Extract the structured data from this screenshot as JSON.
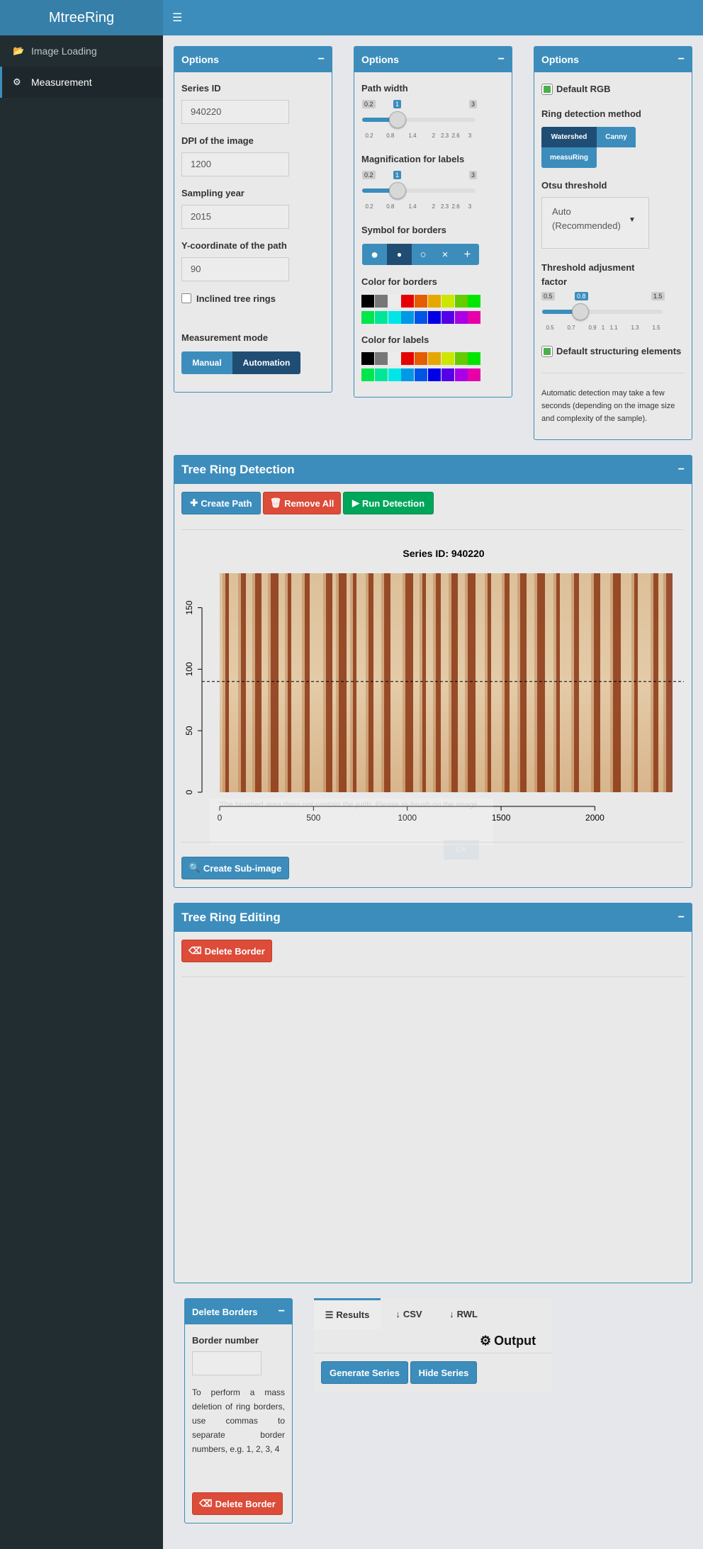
{
  "app": {
    "title": "MtreeRing"
  },
  "sidebar": {
    "items": [
      {
        "label": "Image Loading",
        "icon": "folder-open-icon"
      },
      {
        "label": "Measurement",
        "icon": "gear-icon"
      }
    ]
  },
  "options1": {
    "title": "Options",
    "series_id_label": "Series ID",
    "series_id_value": "940220",
    "dpi_label": "DPI of the image",
    "dpi_value": "1200",
    "year_label": "Sampling year",
    "year_value": "2015",
    "ycoord_label": "Y-coordinate of the path",
    "ycoord_value": "90",
    "inclined_label": "Inclined tree rings",
    "inclined_checked": false,
    "mode_label": "Measurement mode",
    "mode_options": [
      "Manual",
      "Automation"
    ],
    "mode_selected": "Automation"
  },
  "options2": {
    "title": "Options",
    "path_width": {
      "label": "Path width",
      "min": "0.2",
      "max": "3",
      "value": "1",
      "ticks": [
        "0.2",
        "0.8",
        "1.4",
        "2",
        "2.3",
        "2.6",
        "3"
      ]
    },
    "magnification": {
      "label": "Magnification for labels",
      "min": "0.2",
      "max": "3",
      "value": "1",
      "ticks": [
        "0.2",
        "0.8",
        "1.4",
        "2",
        "2.3",
        "2.6",
        "3"
      ]
    },
    "symbol_label": "Symbol for borders",
    "symbols": [
      "●",
      "●",
      "○",
      "×",
      "+"
    ],
    "symbol_selected": 1,
    "border_color_label": "Color for borders",
    "label_color_label": "Color for labels",
    "palette": [
      "#000000",
      "#777777",
      "#ececec",
      "#e60000",
      "#e65c00",
      "#e6a800",
      "#cce600",
      "#66cc00",
      "#00e600",
      "#00e64d",
      "#00e699",
      "#00e6e6",
      "#0099e6",
      "#0055e6",
      "#0000e6",
      "#5500e6",
      "#aa00e6",
      "#e600aa"
    ]
  },
  "options3": {
    "title": "Options",
    "default_rgb_label": "Default RGB",
    "default_rgb_checked": true,
    "method_label": "Ring detection method",
    "methods": [
      "Watershed",
      "Canny",
      "measuRing"
    ],
    "method_selected": "Watershed",
    "otsu_label": "Otsu threshold",
    "otsu_value": "Auto (Recommended)",
    "factor_label": "Threshold adjusment factor",
    "factor": {
      "min": "0.5",
      "max": "1.5",
      "value": "0.8",
      "ticks": [
        "0.5",
        "0.7",
        "0.9",
        "1",
        "1.1",
        "1.3",
        "1.5"
      ]
    },
    "struct_label": "Default structuring elements",
    "struct_checked": true,
    "note": "Automatic detection may take a few seconds (depending on the image size and complexity of the sample)."
  },
  "detection": {
    "title": "Tree Ring Detection",
    "buttons": {
      "create_path": "Create Path",
      "remove_all": "Remove All",
      "run_detection": "Run Detection"
    },
    "sub_image": "Create Sub-image",
    "overlay_text": "The brushed area does not contain the path. Please re-brush on the image.",
    "overlay_ok": "OK"
  },
  "chart_data": {
    "type": "image",
    "title": "Series ID: 940220",
    "xticks": [
      "0",
      "500",
      "1000",
      "1500",
      "2000"
    ],
    "yticks": [
      "0",
      "50",
      "100",
      "150"
    ],
    "xlim": [
      0,
      2380
    ],
    "ylim": [
      0,
      178
    ],
    "path_y": 90,
    "ring_color_light": "#d9b88a",
    "ring_color_dark": "#8a3512"
  },
  "editing": {
    "title": "Tree Ring Editing",
    "delete_border": "Delete Border"
  },
  "delete_borders": {
    "title": "Delete Borders",
    "number_label": "Border number",
    "number_value": "",
    "note": "To perform a mass deletion of ring borders, use commas to separate border numbers, e.g. 1, 2, 3, 4",
    "button": "Delete Border"
  },
  "output": {
    "tabs": [
      "Results",
      "CSV",
      "RWL"
    ],
    "active_tab": "Results",
    "heading": "Output",
    "generate": "Generate Series",
    "hide": "Hide Series"
  }
}
